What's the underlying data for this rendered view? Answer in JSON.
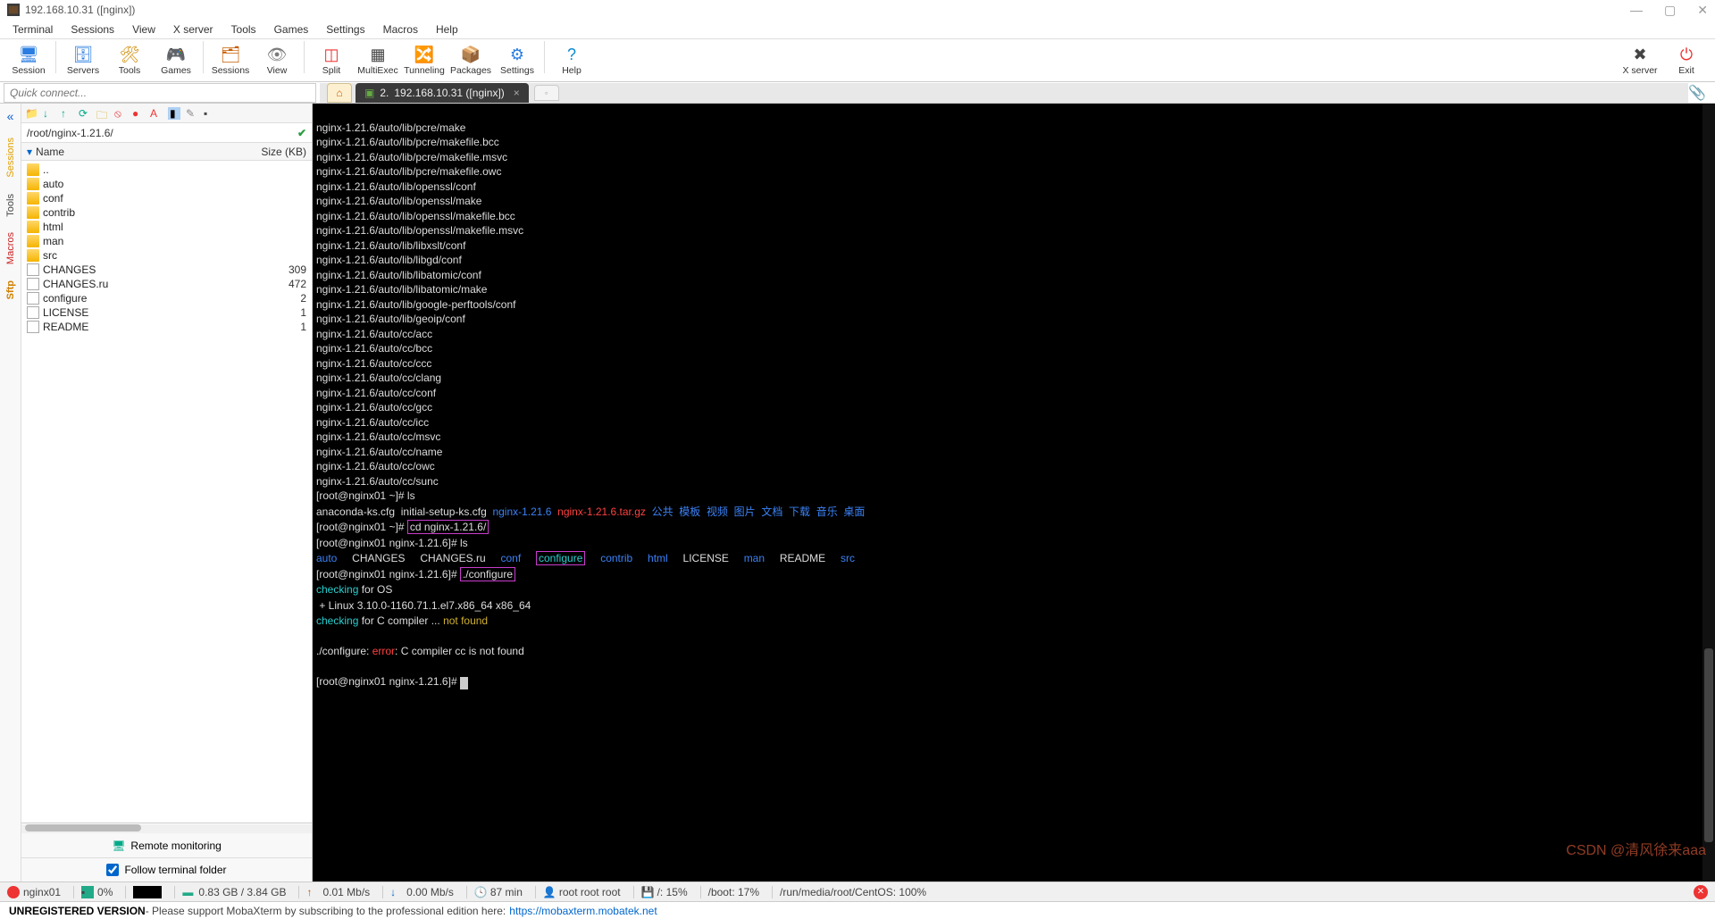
{
  "title": "192.168.10.31 ([nginx])",
  "menus": [
    "Terminal",
    "Sessions",
    "View",
    "X server",
    "Tools",
    "Games",
    "Settings",
    "Macros",
    "Help"
  ],
  "toolbar": [
    {
      "label": "Session",
      "icon": "🖥",
      "color": "#2a7de1"
    },
    {
      "label": "Servers",
      "icon": "🗄",
      "color": "#2a7de1"
    },
    {
      "label": "Tools",
      "icon": "🛠",
      "color": "#d08a00"
    },
    {
      "label": "Games",
      "icon": "🎮",
      "color": "#108a4c"
    },
    {
      "label": "Sessions",
      "icon": "🗂",
      "color": "#c75c00"
    },
    {
      "label": "View",
      "icon": "👁",
      "color": "#7a7a7a"
    },
    {
      "label": "Split",
      "icon": "◫",
      "color": "#e33"
    },
    {
      "label": "MultiExec",
      "icon": "▦",
      "color": "#444"
    },
    {
      "label": "Tunneling",
      "icon": "🔀",
      "color": "#b8860b"
    },
    {
      "label": "Packages",
      "icon": "📦",
      "color": "#8a6d3b"
    },
    {
      "label": "Settings",
      "icon": "⚙",
      "color": "#2a7de1"
    },
    {
      "label": "Help",
      "icon": "?",
      "color": "#0a8ad0"
    }
  ],
  "toolbar_right": [
    {
      "label": "X server",
      "icon": "✖",
      "colors": [
        "#d93025",
        "#fbbc04",
        "#34a853",
        "#4285f4"
      ]
    },
    {
      "label": "Exit",
      "icon": "⏻",
      "color": "#e33"
    }
  ],
  "quick_placeholder": "Quick connect...",
  "tab": {
    "index": "2.",
    "title": "192.168.10.31 ([nginx])"
  },
  "side_tabs": [
    "Sessions",
    "Tools",
    "Macros",
    "Sftp"
  ],
  "path": "/root/nginx-1.21.6/",
  "file_header": {
    "name": "Name",
    "size": "Size (KB)"
  },
  "files": [
    {
      "name": "..",
      "type": "up",
      "size": ""
    },
    {
      "name": "auto",
      "type": "folder",
      "size": ""
    },
    {
      "name": "conf",
      "type": "folder",
      "size": ""
    },
    {
      "name": "contrib",
      "type": "folder",
      "size": ""
    },
    {
      "name": "html",
      "type": "folder",
      "size": ""
    },
    {
      "name": "man",
      "type": "folder",
      "size": ""
    },
    {
      "name": "src",
      "type": "folder",
      "size": ""
    },
    {
      "name": "CHANGES",
      "type": "file",
      "size": "309"
    },
    {
      "name": "CHANGES.ru",
      "type": "file",
      "size": "472"
    },
    {
      "name": "configure",
      "type": "exec",
      "size": "2"
    },
    {
      "name": "LICENSE",
      "type": "file",
      "size": "1"
    },
    {
      "name": "README",
      "type": "file",
      "size": "1"
    }
  ],
  "remote_label": "Remote monitoring",
  "follow_label": "Follow terminal folder",
  "terminal_lines": [
    "nginx-1.21.6/auto/lib/pcre/make",
    "nginx-1.21.6/auto/lib/pcre/makefile.bcc",
    "nginx-1.21.6/auto/lib/pcre/makefile.msvc",
    "nginx-1.21.6/auto/lib/pcre/makefile.owc",
    "nginx-1.21.6/auto/lib/openssl/conf",
    "nginx-1.21.6/auto/lib/openssl/make",
    "nginx-1.21.6/auto/lib/openssl/makefile.bcc",
    "nginx-1.21.6/auto/lib/openssl/makefile.msvc",
    "nginx-1.21.6/auto/lib/libxslt/conf",
    "nginx-1.21.6/auto/lib/libgd/conf",
    "nginx-1.21.6/auto/lib/libatomic/conf",
    "nginx-1.21.6/auto/lib/libatomic/make",
    "nginx-1.21.6/auto/lib/google-perftools/conf",
    "nginx-1.21.6/auto/lib/geoip/conf",
    "nginx-1.21.6/auto/cc/acc",
    "nginx-1.21.6/auto/cc/bcc",
    "nginx-1.21.6/auto/cc/ccc",
    "nginx-1.21.6/auto/cc/clang",
    "nginx-1.21.6/auto/cc/conf",
    "nginx-1.21.6/auto/cc/gcc",
    "nginx-1.21.6/auto/cc/icc",
    "nginx-1.21.6/auto/cc/msvc",
    "nginx-1.21.6/auto/cc/name",
    "nginx-1.21.6/auto/cc/owc",
    "nginx-1.21.6/auto/cc/sunc"
  ],
  "prompt1": "[root@nginx01 ~]# ",
  "ls": "ls",
  "ls_out": {
    "p1": "anaconda-ks.cfg  initial-setup-ks.cfg  ",
    "d1": "nginx-1.21.6",
    "sp1": "  ",
    "r1": "nginx-1.21.6.tar.gz",
    "sp2": "  ",
    "cn": [
      "公共",
      "模板",
      "视频",
      "图片",
      "文档",
      "下载",
      "音乐",
      "桌面"
    ]
  },
  "cd_cmd": "cd nginx-1.21.6/",
  "prompt2": "[root@nginx01 nginx-1.21.6]# ",
  "ls2_dirs": [
    "auto"
  ],
  "ls2_plain": [
    "CHANGES",
    "CHANGES.ru"
  ],
  "ls2_conf": "conf",
  "ls2_cfg": "configure",
  "ls2_dirs2": [
    "contrib",
    "html"
  ],
  "ls2_lic": "LICENSE",
  "ls2_man": "man",
  "ls2_rm": "README",
  "ls2_src": "src",
  "configure_cmd": "./configure",
  "chk1a": "checking",
  "chk1b": " for OS",
  "linux_line": " + Linux 3.10.0-1160.71.1.el7.x86_64 x86_64",
  "chk2a": "checking",
  "chk2b": " for C compiler ... ",
  "chk2c": "not found",
  "err_a": "./configure: ",
  "err_b": "error",
  "err_c": ": C compiler cc is not found",
  "final_prompt": "[root@nginx01 nginx-1.21.6]# ",
  "status": {
    "host": "nginx01",
    "cpu": "0%",
    "mem": "0.83 GB / 3.84 GB",
    "up": "0.01 Mb/s",
    "down": "0.00 Mb/s",
    "time": "87 min",
    "user": "root  root  root",
    "disk1": "/: 15%",
    "disk2": "/boot: 17%",
    "disk3": "/run/media/root/CentOS: 100%"
  },
  "footer": {
    "bold": "UNREGISTERED VERSION",
    "text": " -  Please support MobaXterm by subscribing to the professional edition here:  ",
    "link": "https://mobaxterm.mobatek.net"
  },
  "watermark": "CSDN @清风徐来aaa"
}
